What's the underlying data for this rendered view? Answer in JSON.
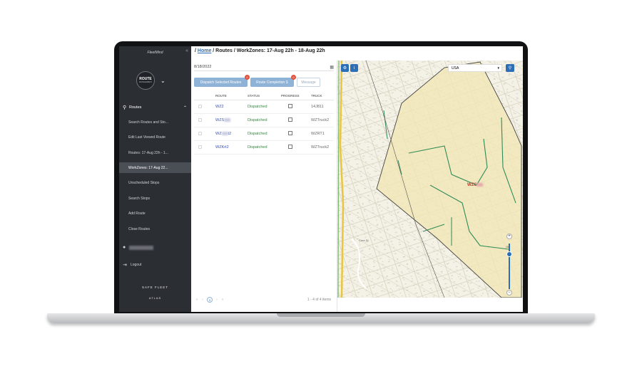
{
  "sidebar": {
    "brand": "FleetMind",
    "collapse_glyph": "«",
    "module": {
      "title": "ROUTE",
      "subtitle": "MANAGEMENT",
      "icon": "route-pin-icon"
    },
    "group": {
      "label": "Routes",
      "icon": "routes-icon"
    },
    "items": [
      {
        "label": "Search Routes and Sto..."
      },
      {
        "label": "Edit Last Viewed Route"
      },
      {
        "label": "Routes: 17-Aug 22h - 1..."
      },
      {
        "label": "WorkZones: 17-Aug 22..."
      },
      {
        "label": "Unscheduled Stops"
      },
      {
        "label": "Search Stops"
      },
      {
        "label": "Add Route"
      },
      {
        "label": "Close Routes"
      }
    ],
    "logout": "Logout",
    "footer": "SAFE FLEET",
    "footer_sub": "ATLAS"
  },
  "breadcrumb": {
    "prefix": "/ ",
    "home": "Home",
    "rest": " / Routes / WorkZones: 17-Aug 22h - 18-Aug 22h"
  },
  "panel": {
    "date": "8/18/2022",
    "dispatch_btn": "Dispatch Selected Routes",
    "dispatch_badge": "0",
    "completion_btn": "Route Completion S",
    "completion_badge": "0",
    "message_btn": "Message"
  },
  "table": {
    "headers": {
      "route": "ROUTE",
      "status": "STATUS",
      "progress": "PROGRESS",
      "truck": "TRUCK"
    },
    "rows": [
      {
        "route": "WZ2",
        "status": "Dispatched",
        "truck": "14J811"
      },
      {
        "route": "WZS",
        "status": "Dispatched",
        "truck": "WZTruck2"
      },
      {
        "route": "WZ",
        "route_suffix": "t2",
        "status": "Dispatched",
        "truck": "WZRT1"
      },
      {
        "route": "WZKrt2",
        "status": "Dispatched",
        "truck": "WZTruck2"
      }
    ]
  },
  "pager": {
    "page": "1",
    "info": "1 - 4 of 4 items"
  },
  "map": {
    "country": "USA",
    "zone_label": "WZS",
    "street": "Cree St",
    "zoom_level": "15"
  },
  "colors": {
    "sidebar_bg": "#2b2e33",
    "accent": "#2c6fb7",
    "status_green": "#2e8b3a",
    "route_link": "#3a4fb0",
    "badge_red": "#e0503c",
    "zone_fill": "#f1e7b5"
  }
}
